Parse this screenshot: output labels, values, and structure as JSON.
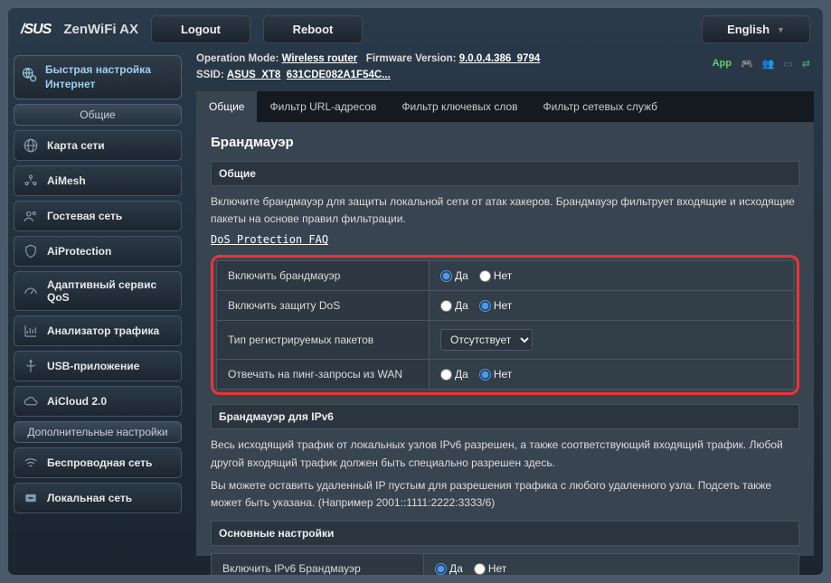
{
  "header": {
    "logo": "/SUS",
    "model": "ZenWiFi AX",
    "logout": "Logout",
    "reboot": "Reboot",
    "language": "English"
  },
  "info": {
    "operation_mode_k": "Operation Mode:",
    "operation_mode_v": "Wireless router",
    "firmware_k": "Firmware Version:",
    "firmware_v": "9.0.0.4.386_9794",
    "ssid_k": "SSID:",
    "ssid_v1": "ASUS_XT8",
    "ssid_v2": "631CDE082A1F54C..."
  },
  "appbar": {
    "app": "App"
  },
  "sidebar": {
    "qis": "Быстрая настройка Интернет",
    "section1": "Общие",
    "items1": [
      {
        "label": "Карта сети"
      },
      {
        "label": "AiMesh"
      },
      {
        "label": "Гостевая сеть"
      },
      {
        "label": "AiProtection"
      },
      {
        "label": "Адаптивный сервис QoS"
      },
      {
        "label": "Анализатор трафика"
      },
      {
        "label": "USB-приложение"
      },
      {
        "label": "AiCloud 2.0"
      }
    ],
    "section2": "Дополнительные настройки",
    "items2": [
      {
        "label": "Беспроводная сеть"
      },
      {
        "label": "Локальная сеть"
      }
    ]
  },
  "tabs": [
    "Общие",
    "Фильтр URL-адресов",
    "Фильтр ключевых слов",
    "Фильтр сетевых служб"
  ],
  "panel": {
    "title": "Брандмауэр",
    "general_head": "Общие",
    "general_desc": "Включите брандмауэр для защиты локальной сети от атак хакеров. Брандмауэр фильтрует входящие и исходящие пакеты на основе правил фильтрации.",
    "faq": "DoS Protection FAQ",
    "rows": [
      {
        "label": "Включить брандмауэр",
        "type": "radio",
        "value": "yes"
      },
      {
        "label": "Включить защиту DoS",
        "type": "radio",
        "value": "no"
      },
      {
        "label": "Тип регистрируемых пакетов",
        "type": "select",
        "selected": "Отсутствует"
      },
      {
        "label": "Отвечать на пинг-запросы из WAN",
        "type": "radio",
        "value": "no"
      }
    ],
    "yes": "Да",
    "no": "Нет",
    "ipv6_head": "Брандмауэр для IPv6",
    "ipv6_desc1": "Весь исходящий трафик от локальных узлов IPv6 разрешен, а также соответствующий входящий трафик. Любой другой входящий трафик должен быть специально разрешен здесь.",
    "ipv6_desc2": "Вы можете оставить удаленный IP пустым для разрешения трафика с любого удаленного узла. Подсеть также может быть указана. (Например 2001::1111:2222:3333/6)",
    "basic_head": "Основные настройки",
    "ipv6_row": "Включить IPv6 Брандмауэр"
  }
}
